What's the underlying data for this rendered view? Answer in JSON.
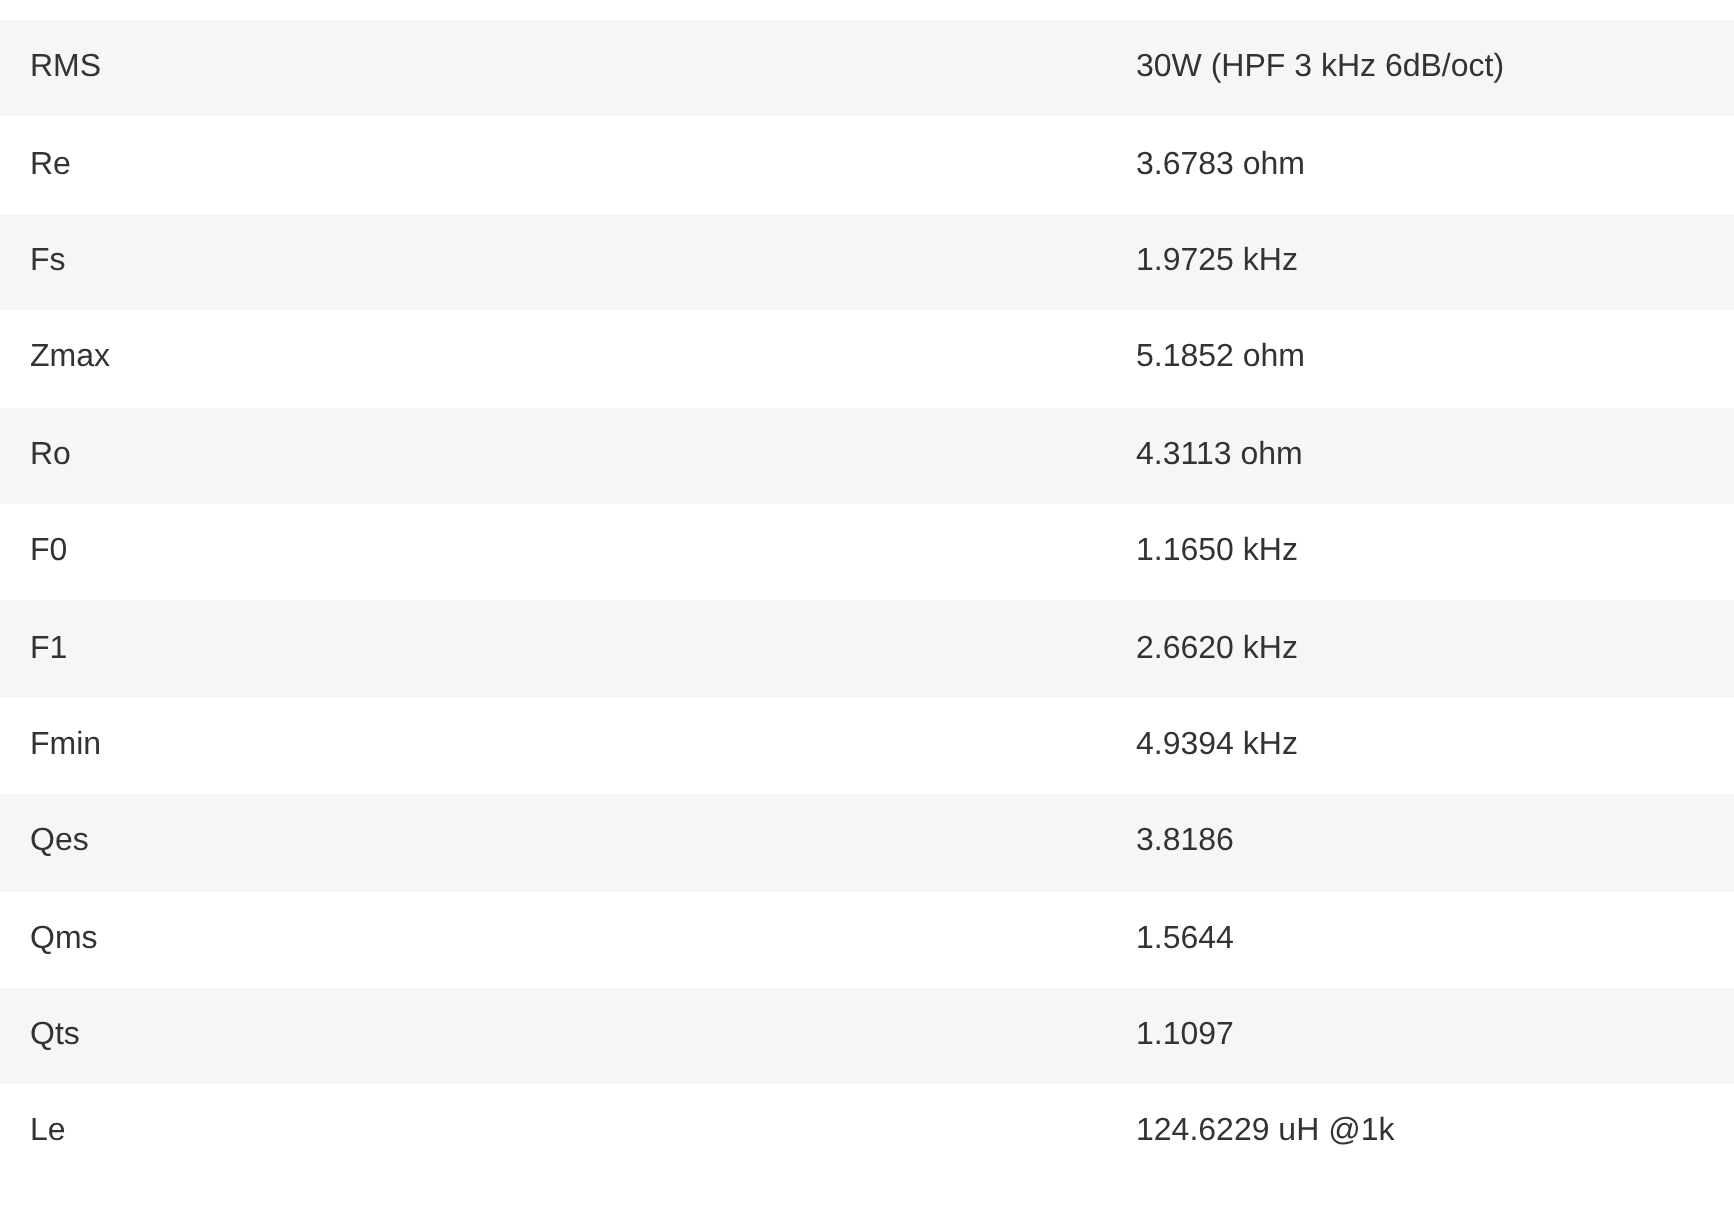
{
  "table": {
    "rows": [
      {
        "parameter": "RMS",
        "value": "30W (HPF 3 kHz 6dB/oct)"
      },
      {
        "parameter": "Re",
        "value": "3.6783 ohm"
      },
      {
        "parameter": "Fs",
        "value": "1.9725 kHz"
      },
      {
        "parameter": "Zmax",
        "value": "5.1852 ohm"
      },
      {
        "parameter": "Ro",
        "value": "4.3113 ohm"
      },
      {
        "parameter": "F0",
        "value": "1.1650 kHz"
      },
      {
        "parameter": "F1",
        "value": "2.6620 kHz"
      },
      {
        "parameter": "Fmin",
        "value": "4.9394 kHz"
      },
      {
        "parameter": "Qes",
        "value": "3.8186"
      },
      {
        "parameter": "Qms",
        "value": "1.5644"
      },
      {
        "parameter": "Qts",
        "value": "1.1097"
      },
      {
        "parameter": "Le",
        "value": "124.6229 uH @1k"
      }
    ]
  }
}
